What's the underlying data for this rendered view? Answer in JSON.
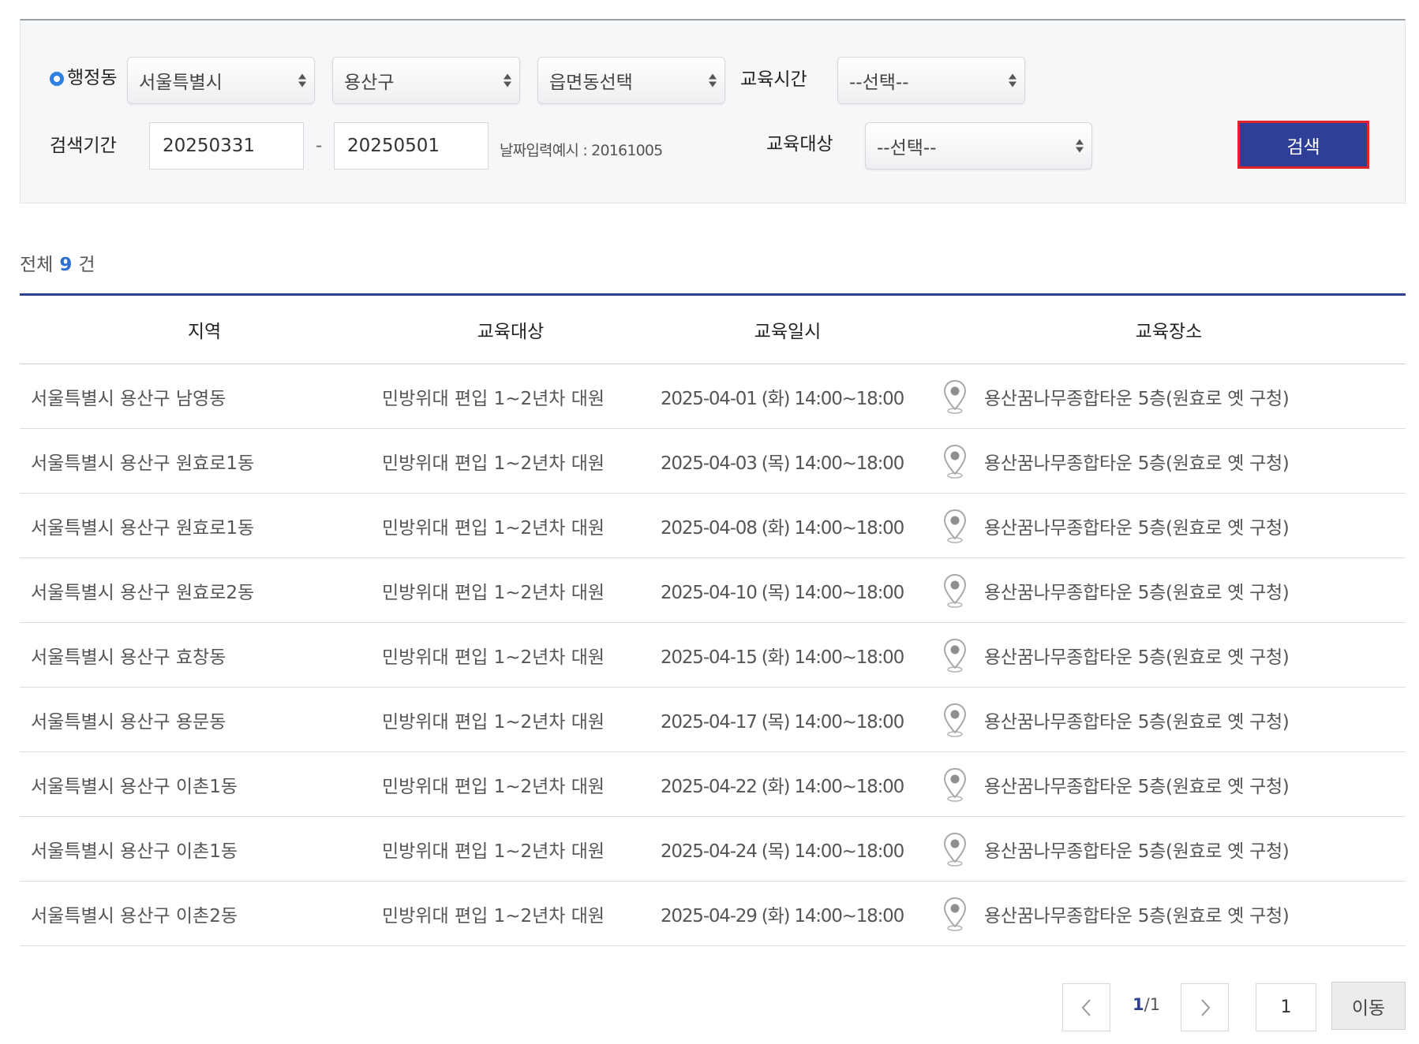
{
  "filters": {
    "region_label": "행정동",
    "city_value": "서울특별시",
    "district_value": "용산구",
    "dong_value": "읍면동선택",
    "time_label": "교육시간",
    "time_value": "--선택--",
    "period_label": "검색기간",
    "start_date": "20250331",
    "date_separator": "-",
    "end_date": "20250501",
    "date_hint": "날짜입력예시 : 20161005",
    "target_label": "교육대상",
    "target_value": "--선택--",
    "search_button": "검색"
  },
  "summary": {
    "prefix": "전체",
    "count": "9",
    "suffix": "건"
  },
  "table": {
    "headers": [
      "지역",
      "교육대상",
      "교육일시",
      "교육장소"
    ],
    "rows": [
      {
        "region": "서울특별시 용산구 남영동",
        "target": "민방위대 편입 1~2년차 대원",
        "datetime": "2025-04-01 (화) 14:00~18:00",
        "location": "용산꿈나무종합타운 5층(원효로 옛 구청)"
      },
      {
        "region": "서울특별시 용산구 원효로1동",
        "target": "민방위대 편입 1~2년차 대원",
        "datetime": "2025-04-03 (목) 14:00~18:00",
        "location": "용산꿈나무종합타운 5층(원효로 옛 구청)"
      },
      {
        "region": "서울특별시 용산구 원효로1동",
        "target": "민방위대 편입 1~2년차 대원",
        "datetime": "2025-04-08 (화) 14:00~18:00",
        "location": "용산꿈나무종합타운 5층(원효로 옛 구청)"
      },
      {
        "region": "서울특별시 용산구 원효로2동",
        "target": "민방위대 편입 1~2년차 대원",
        "datetime": "2025-04-10 (목) 14:00~18:00",
        "location": "용산꿈나무종합타운 5층(원효로 옛 구청)"
      },
      {
        "region": "서울특별시 용산구 효창동",
        "target": "민방위대 편입 1~2년차 대원",
        "datetime": "2025-04-15 (화) 14:00~18:00",
        "location": "용산꿈나무종합타운 5층(원효로 옛 구청)"
      },
      {
        "region": "서울특별시 용산구 용문동",
        "target": "민방위대 편입 1~2년차 대원",
        "datetime": "2025-04-17 (목) 14:00~18:00",
        "location": "용산꿈나무종합타운 5층(원효로 옛 구청)"
      },
      {
        "region": "서울특별시 용산구 이촌1동",
        "target": "민방위대 편입 1~2년차 대원",
        "datetime": "2025-04-22 (화) 14:00~18:00",
        "location": "용산꿈나무종합타운 5층(원효로 옛 구청)"
      },
      {
        "region": "서울특별시 용산구 이촌1동",
        "target": "민방위대 편입 1~2년차 대원",
        "datetime": "2025-04-24 (목) 14:00~18:00",
        "location": "용산꿈나무종합타운 5층(원효로 옛 구청)"
      },
      {
        "region": "서울특별시 용산구 이촌2동",
        "target": "민방위대 편입 1~2년차 대원",
        "datetime": "2025-04-29 (화) 14:00~18:00",
        "location": "용산꿈나무종합타운 5층(원효로 옛 구청)"
      }
    ]
  },
  "pagination": {
    "current": "1",
    "separator": "/",
    "total": "1",
    "page_input": "1",
    "go_button": "이동"
  },
  "icons": {
    "radio": "radio-selected-icon",
    "select_arrow": "updown-arrow-icon",
    "pin": "map-pin-icon",
    "prev": "chevron-left-icon",
    "next": "chevron-right-icon"
  },
  "colors": {
    "accent": "#2f3f98",
    "button_border": "#e1242b",
    "count": "#2e6fd0",
    "radio": "#2e7ee3"
  }
}
